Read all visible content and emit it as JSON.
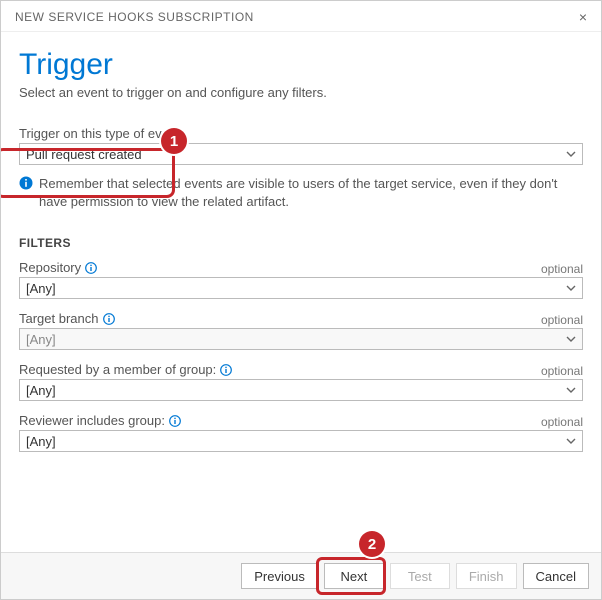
{
  "dialog": {
    "title": "NEW SERVICE HOOKS SUBSCRIPTION"
  },
  "page": {
    "title": "Trigger",
    "subtitle": "Select an event to trigger on and configure any filters."
  },
  "event": {
    "label": "Trigger on this type of event",
    "value": "Pull request created"
  },
  "info": {
    "text": "Remember that selected events are visible to users of the target service, even if they don't have permission to view the related artifact."
  },
  "filters": {
    "heading": "FILTERS",
    "items": [
      {
        "label": "Repository",
        "optional": "optional",
        "value": "[Any]",
        "info": true,
        "disabled": false
      },
      {
        "label": "Target branch",
        "optional": "optional",
        "value": "[Any]",
        "info": true,
        "disabled": true
      },
      {
        "label": "Requested by a member of group:",
        "optional": "optional",
        "value": "[Any]",
        "info": true,
        "disabled": false
      },
      {
        "label": "Reviewer includes group:",
        "optional": "optional",
        "value": "[Any]",
        "info": true,
        "disabled": false
      }
    ]
  },
  "buttons": {
    "previous": "Previous",
    "next": "Next",
    "test": "Test",
    "finish": "Finish",
    "cancel": "Cancel"
  },
  "callouts": {
    "one": "1",
    "two": "2"
  }
}
